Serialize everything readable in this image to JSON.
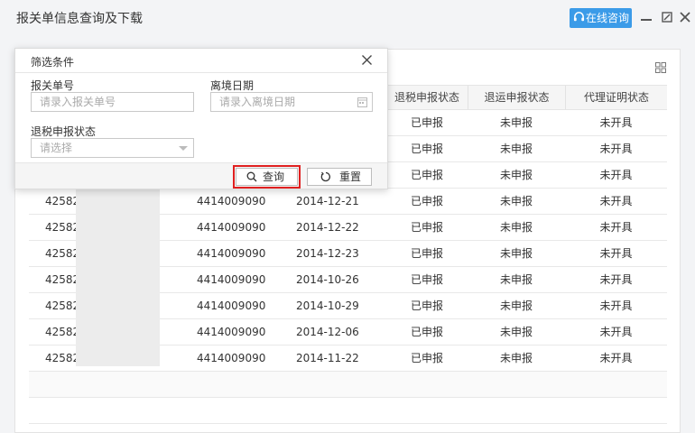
{
  "window": {
    "title": "报关单信息查询及下载",
    "online_label": "在线咨询"
  },
  "table": {
    "headers": [
      "退税申报状态",
      "退运申报状态",
      "代理证明状态"
    ],
    "rows": [
      {
        "id": "",
        "code": "",
        "date": "",
        "tax": "已申报",
        "ret": "未申报",
        "cert": "未开具"
      },
      {
        "id": "",
        "code": "",
        "date": "",
        "tax": "已申报",
        "ret": "未申报",
        "cert": "未开具"
      },
      {
        "id": "",
        "code": "",
        "date": "",
        "tax": "已申报",
        "ret": "未申报",
        "cert": "未开具"
      },
      {
        "id": "425820",
        "code": "4414009090",
        "date": "2014-12-21",
        "tax": "已申报",
        "ret": "未申报",
        "cert": "未开具"
      },
      {
        "id": "425820",
        "code": "4414009090",
        "date": "2014-12-22",
        "tax": "已申报",
        "ret": "未申报",
        "cert": "未开具"
      },
      {
        "id": "425820",
        "code": "4414009090",
        "date": "2014-12-23",
        "tax": "已申报",
        "ret": "未申报",
        "cert": "未开具"
      },
      {
        "id": "425820",
        "code": "4414009090",
        "date": "2014-10-26",
        "tax": "已申报",
        "ret": "未申报",
        "cert": "未开具"
      },
      {
        "id": "425820",
        "code": "4414009090",
        "date": "2014-10-29",
        "tax": "已申报",
        "ret": "未申报",
        "cert": "未开具"
      },
      {
        "id": "425820",
        "code": "4414009090",
        "date": "2014-12-06",
        "tax": "已申报",
        "ret": "未申报",
        "cert": "未开具"
      },
      {
        "id": "425820",
        "code": "4414009090",
        "date": "2014-11-22",
        "tax": "已申报",
        "ret": "未申报",
        "cert": "未开具"
      }
    ]
  },
  "filter": {
    "title": "筛选条件",
    "declaration_no_label": "报关单号",
    "declaration_no_placeholder": "请录入报关单号",
    "exit_date_label": "离境日期",
    "exit_date_placeholder": "请录入离境日期",
    "tax_status_label": "退税申报状态",
    "tax_status_placeholder": "请选择",
    "search_label": "查询",
    "reset_label": "重置"
  },
  "colors": {
    "accent": "#3b9be8",
    "highlight": "#e02020"
  }
}
